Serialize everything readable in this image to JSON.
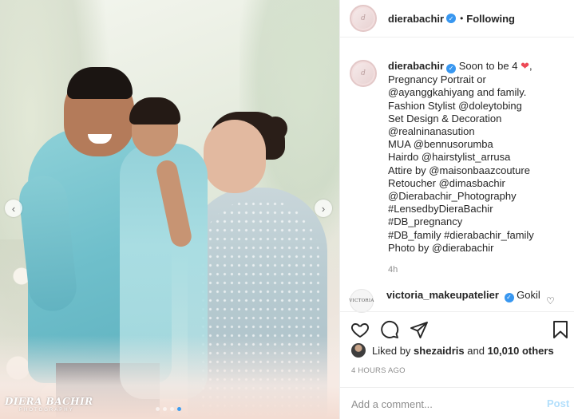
{
  "photo": {
    "watermark_title": "DIERA BACHIR",
    "watermark_subtitle": "PHOTOGRAPHY",
    "nav_prev_icon": "chevron-left-icon",
    "nav_next_icon": "chevron-right-icon",
    "carousel_dots": 4,
    "carousel_active_index": 3
  },
  "header": {
    "avatar_text": "dierabachir",
    "username": "dierabachir",
    "separator": "•",
    "follow_label": "Following"
  },
  "caption": {
    "username": "dierabachir",
    "lines": [
      "Soon to be 4",
      "Pregnancy Portrait or",
      "@ayanggkahiyang and family.",
      "Fashion Stylist @doleytobing",
      "Set Design & Decoration",
      "@realninanasution",
      "MUA @bennusorumba",
      "Hairdo @hairstylist_arrusa",
      "Attire by @maisonbaazcouture",
      "Retoucher @dimasbachir",
      "@Dierabachir_Photography",
      "#LensedbyDieraBachir",
      "#DB_pregnancy",
      "#DB_family #dierabachir_family",
      "Photo by @dierabachir"
    ],
    "time": "4h",
    "accent_color": "#ed4956"
  },
  "comment": {
    "avatar_text": "VICTORIA",
    "username": "victoria_makeupatelier",
    "text": "Gokil"
  },
  "actions": {
    "like_icon": "heart-icon",
    "comment_icon": "comment-icon",
    "share_icon": "share-icon",
    "save_icon": "bookmark-icon"
  },
  "likes": {
    "prefix": "Liked by ",
    "user": "shezaidris",
    "middle": " and ",
    "count": "10,010 others"
  },
  "date": "4 HOURS AGO",
  "add_comment": {
    "placeholder": "Add a comment...",
    "post_label": "Post"
  },
  "colors": {
    "verified": "#3897f0",
    "post_disabled": "#b2dffc",
    "muted": "#8e8e8e"
  }
}
